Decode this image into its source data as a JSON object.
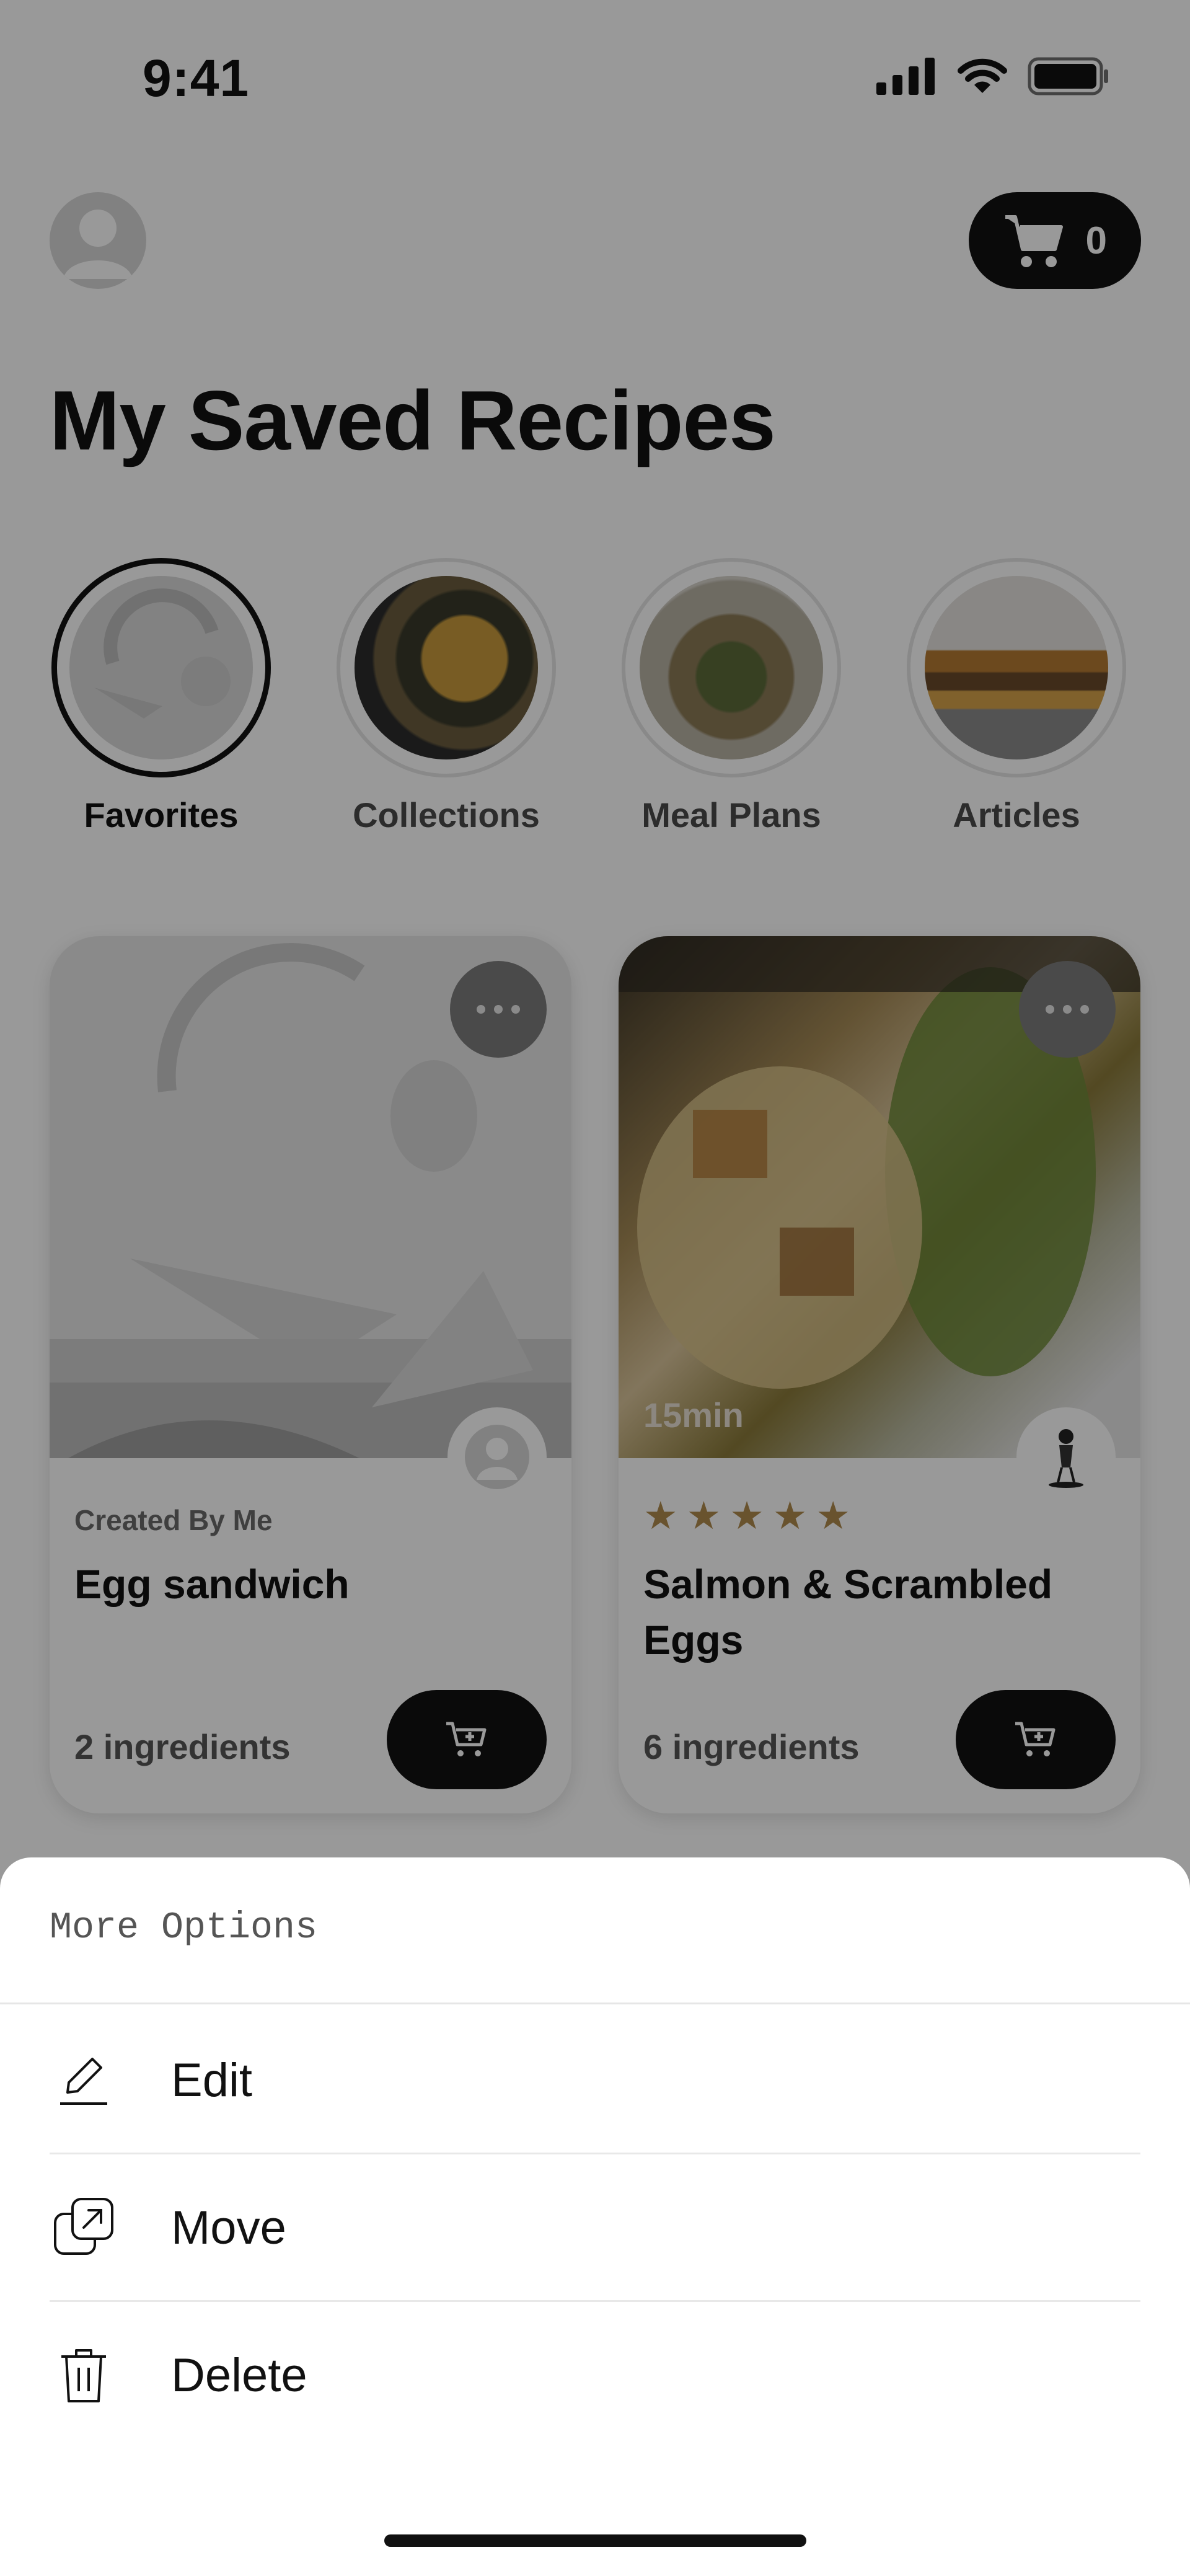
{
  "status_bar": {
    "time": "9:41"
  },
  "header": {
    "cart_count": "0",
    "title": "My Saved Recipes"
  },
  "categories": [
    {
      "label": "Favorites",
      "active": true
    },
    {
      "label": "Collections",
      "active": false
    },
    {
      "label": "Meal Plans",
      "active": false
    },
    {
      "label": "Articles",
      "active": false
    }
  ],
  "cards": [
    {
      "subtitle": "Created By Me",
      "name": "Egg sandwich",
      "ingredients": "2 ingredients"
    },
    {
      "duration": "15min",
      "rating": 5,
      "name": "Salmon & Scrambled Eggs",
      "ingredients": "6 ingredients"
    }
  ],
  "sheet": {
    "title": "More Options",
    "options": [
      {
        "label": "Edit",
        "icon": "pencil-icon"
      },
      {
        "label": "Move",
        "icon": "move-icon"
      },
      {
        "label": "Delete",
        "icon": "trash-icon"
      }
    ]
  },
  "colors": {
    "accent": "#111111",
    "star": "#b08a4e",
    "overlay": "rgba(0,0,0,0.40)"
  }
}
